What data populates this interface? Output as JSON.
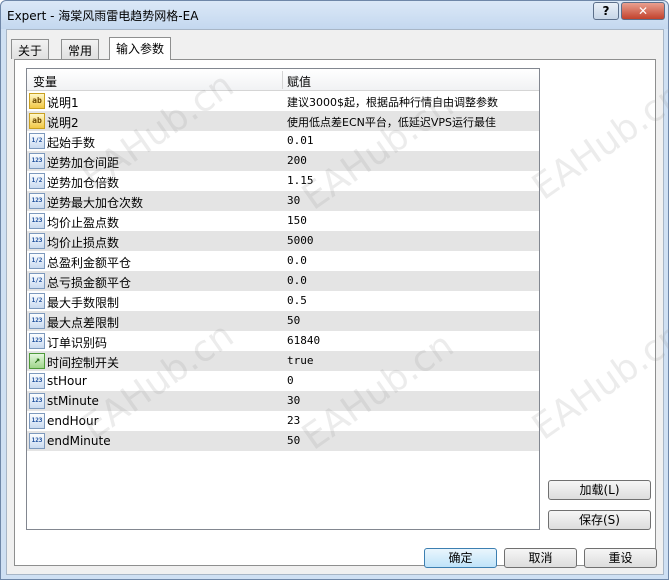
{
  "window": {
    "title": "Expert - 海棠风雨雷电趋势网格-EA",
    "help_label": "?",
    "close_label": "✕"
  },
  "tabs": [
    {
      "label": "关于",
      "active": false
    },
    {
      "label": "常用",
      "active": false
    },
    {
      "label": "输入参数",
      "active": true
    }
  ],
  "grid": {
    "headers": {
      "variable": "变量",
      "value": "赋值"
    },
    "rows": [
      {
        "name": "说明1",
        "value": "建议3000$起，根据品种行情自由调整参数",
        "icon": "ab"
      },
      {
        "name": "说明2",
        "value": "使用低点差ECN平台，低延迟VPS运行最佳",
        "icon": "ab"
      },
      {
        "name": "起始手数",
        "value": "0.01",
        "icon": "double"
      },
      {
        "name": "逆势加仓间距",
        "value": "200",
        "icon": "int"
      },
      {
        "name": "逆势加仓倍数",
        "value": "1.15",
        "icon": "double"
      },
      {
        "name": "逆势最大加仓次数",
        "value": "30",
        "icon": "int"
      },
      {
        "name": "均价止盈点数",
        "value": "150",
        "icon": "int"
      },
      {
        "name": "均价止损点数",
        "value": "5000",
        "icon": "int"
      },
      {
        "name": "总盈利金额平仓",
        "value": "0.0",
        "icon": "double"
      },
      {
        "name": "总亏损金额平仓",
        "value": "0.0",
        "icon": "double"
      },
      {
        "name": "最大手数限制",
        "value": "0.5",
        "icon": "double"
      },
      {
        "name": "最大点差限制",
        "value": "50",
        "icon": "int"
      },
      {
        "name": "订单识别码",
        "value": "61840",
        "icon": "int"
      },
      {
        "name": "时间控制开关",
        "value": "true",
        "icon": "bool"
      },
      {
        "name": "stHour",
        "value": "0",
        "icon": "int"
      },
      {
        "name": "stMinute",
        "value": "30",
        "icon": "int"
      },
      {
        "name": "endHour",
        "value": "23",
        "icon": "int"
      },
      {
        "name": "endMinute",
        "value": "50",
        "icon": "int"
      }
    ]
  },
  "icon_labels": {
    "ab": "ab",
    "double": "1/2",
    "int": "123",
    "bool": "↗"
  },
  "side_buttons": {
    "load": "加载(L)",
    "save": "保存(S)"
  },
  "bottom_buttons": {
    "ok": "确定",
    "cancel": "取消",
    "reset": "重设"
  },
  "watermark": "EAHub.cn"
}
